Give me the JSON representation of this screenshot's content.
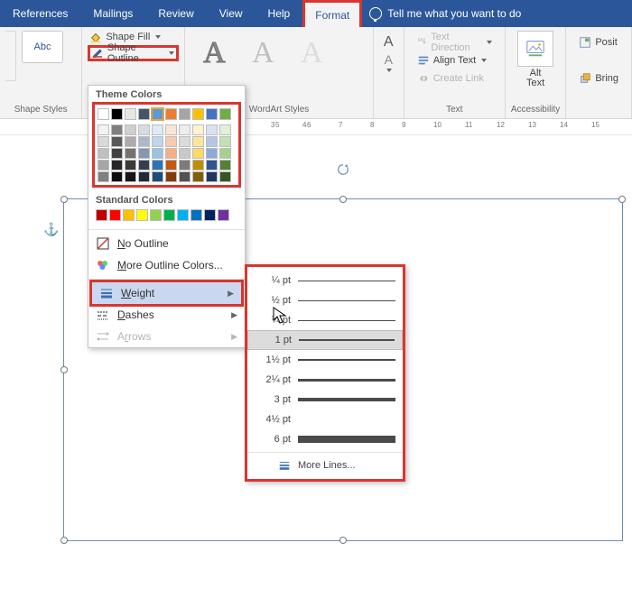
{
  "tabs": {
    "references": "References",
    "mailings": "Mailings",
    "review": "Review",
    "view": "View",
    "help": "Help",
    "format": "Format",
    "tellme": "Tell me what you want to do"
  },
  "ribbon": {
    "shape_styles_sample": "Abc",
    "shape_fill": "Shape Fill",
    "shape_outline": "Shape Outline",
    "group_shape_styles": "Shape Styles",
    "group_wordart": "WordArt Styles",
    "group_text": "Text",
    "group_accessibility": "Accessibility",
    "wa_glyph": "A",
    "text_direction": "Text Direction",
    "align_text": "Align Text",
    "create_link": "Create Link",
    "alt_text_top": "Alt",
    "alt_text_bottom": "Text",
    "position": "Posit",
    "bring": "Bring"
  },
  "ruler": {
    "n3": "3",
    "n4": "4",
    "n5": "5",
    "n6": "6",
    "n7": "7",
    "n8": "8",
    "n9": "9",
    "n10": "10",
    "n11": "11",
    "n12": "12",
    "n13": "13",
    "n14": "14",
    "n15": "15"
  },
  "dropdown": {
    "theme_colors": "Theme Colors",
    "standard_colors": "Standard Colors",
    "no_outline_pre": "",
    "no_outline_u": "N",
    "no_outline_post": "o Outline",
    "more_colors_pre": "",
    "more_colors_u": "M",
    "more_colors_post": "ore Outline Colors...",
    "weight_pre": "",
    "weight_u": "W",
    "weight_post": "eight",
    "dashes_pre": "",
    "dashes_u": "D",
    "dashes_post": "ashes",
    "arrows_pre": "A",
    "arrows_u": "r",
    "arrows_post": "rows",
    "theme_row_colors": [
      "#ffffff",
      "#000000",
      "#e7e6e6",
      "#44546a",
      "#5b9bd5",
      "#ed7d31",
      "#a5a5a5",
      "#ffc000",
      "#4472c4",
      "#70ad47"
    ],
    "tint_cols": [
      [
        "#f2f2f2",
        "#d9d9d9",
        "#bfbfbf",
        "#a6a6a6",
        "#808080"
      ],
      [
        "#7f7f7f",
        "#595959",
        "#404040",
        "#262626",
        "#0d0d0d"
      ],
      [
        "#d0cece",
        "#aeaaaa",
        "#767171",
        "#3b3838",
        "#161616"
      ],
      [
        "#d5dce4",
        "#acb9ca",
        "#8496b0",
        "#333f4f",
        "#222b35"
      ],
      [
        "#deeaf6",
        "#bdd6ee",
        "#9cc2e5",
        "#2e74b5",
        "#1f4d78"
      ],
      [
        "#fbe4d5",
        "#f7caac",
        "#f4b083",
        "#c45911",
        "#833c0b"
      ],
      [
        "#ededed",
        "#dbdbdb",
        "#c9c9c9",
        "#7b7b7b",
        "#525252"
      ],
      [
        "#fff2cc",
        "#ffe599",
        "#ffd966",
        "#bf8f00",
        "#806000"
      ],
      [
        "#d9e2f3",
        "#b4c6e7",
        "#8eaadb",
        "#2f5496",
        "#1f3763"
      ],
      [
        "#e2efd9",
        "#c5e0b3",
        "#a8d08d",
        "#538135",
        "#375623"
      ]
    ],
    "standard_row_colors": [
      "#c00000",
      "#ff0000",
      "#ffc000",
      "#ffff00",
      "#92d050",
      "#00b050",
      "#00b0f0",
      "#0070c0",
      "#002060",
      "#7030a0"
    ]
  },
  "weights": {
    "w025": "¼ pt",
    "w05": "½ pt",
    "w075": "¾ pt",
    "w1": "1 pt",
    "w15": "1½ pt",
    "w225": "2¼ pt",
    "w3": "3 pt",
    "w45": "4½ pt",
    "w6": "6 pt",
    "more_lines": "More Lines..."
  }
}
